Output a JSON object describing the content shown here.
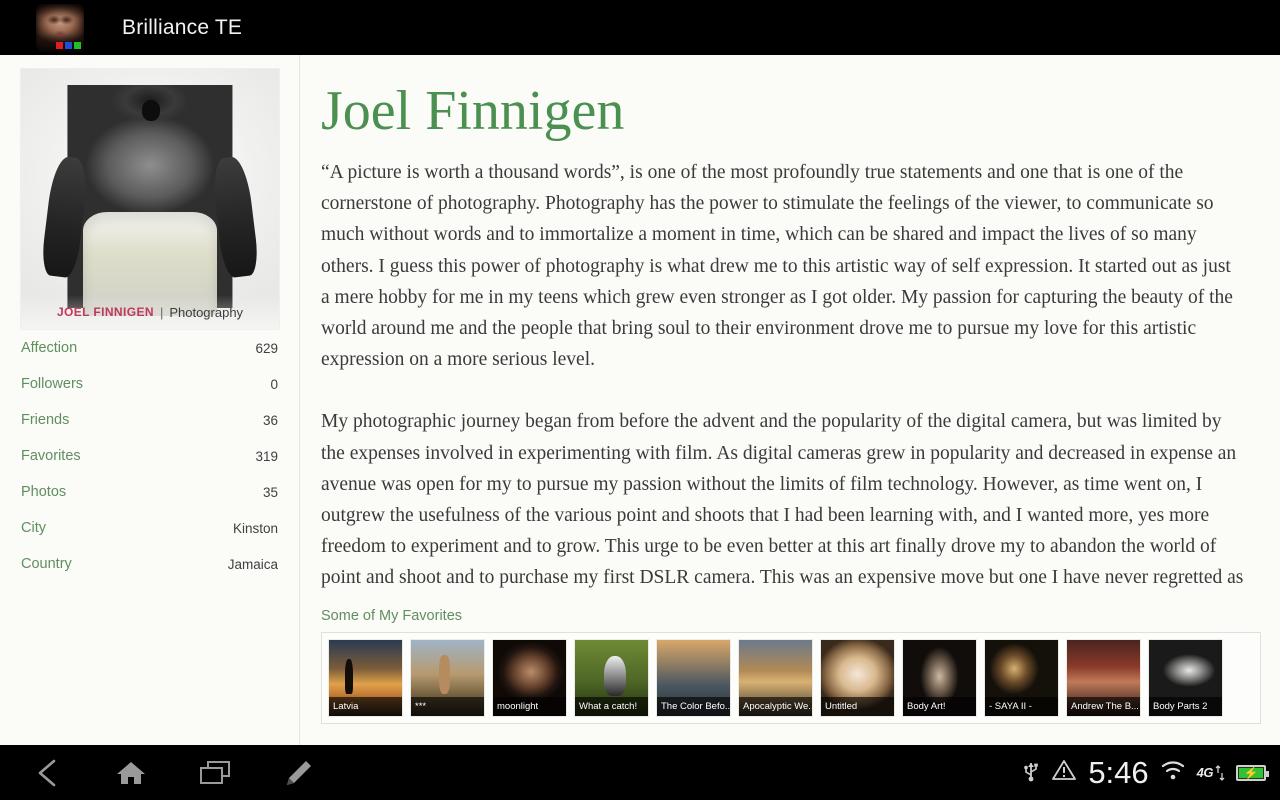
{
  "appbar": {
    "title": "Brilliance TE",
    "icon_name": "app-face-icon"
  },
  "sidebar": {
    "avatar": {
      "watermark_name": "JOEL FINNIGEN",
      "watermark_sep": "|",
      "watermark_kind": "Photography"
    },
    "stats": [
      {
        "label": "Affection",
        "value": "629"
      },
      {
        "label": "Followers",
        "value": "0"
      },
      {
        "label": "Friends",
        "value": "36"
      },
      {
        "label": "Favorites",
        "value": "319"
      },
      {
        "label": "Photos",
        "value": "35"
      },
      {
        "label": "City",
        "value": "Kinston"
      },
      {
        "label": "Country",
        "value": "Jamaica"
      }
    ]
  },
  "profile": {
    "name": "Joel Finnigen",
    "bio_paragraphs": [
      "“A picture is worth a thousand words”, is one of the most profoundly true statements and one that is one of the cornerstone of photography. Photography has the power to stimulate the feelings of the viewer, to communicate so much without words and to immortalize a moment in time, which can be shared and impact the lives of so many others. I guess this power of photography is what drew me to this artistic way of self expression. It started out as just a mere hobby for me in my teens which grew even stronger as I got older. My passion for capturing the beauty of the world around me and the people that bring soul to their environment drove me to pursue my love for this artistic expression on a more serious level.",
      "My photographic journey began from before the advent and the popularity of the digital camera, but was limited by the expenses involved in experimenting with film. As digital cameras grew in popularity and decreased in expense an avenue was open for my to pursue my passion without the limits of film technology. However, as time went on, I outgrew the usefulness of the various point and shoots that I had been learning with, and I wanted more, yes more freedom to experiment and to grow. This urge to be even better at this art finally drove my to abandon the world of point and shoot and to purchase my first DSLR camera. This was an expensive move but one I have never regretted as"
    ]
  },
  "favorites": {
    "heading": "Some of My Favorites",
    "items": [
      {
        "caption": "Latvia"
      },
      {
        "caption": "***"
      },
      {
        "caption": "moonlight"
      },
      {
        "caption": "What a catch!"
      },
      {
        "caption": "The Color Befo..."
      },
      {
        "caption": "Apocalyptic We..."
      },
      {
        "caption": "Untitled"
      },
      {
        "caption": "Body Art!"
      },
      {
        "caption": "- SAYA II -"
      },
      {
        "caption": "Andrew The B..."
      },
      {
        "caption": "Body Parts 2"
      }
    ]
  },
  "systembar": {
    "nav": [
      {
        "icon": "back-icon"
      },
      {
        "icon": "home-icon"
      },
      {
        "icon": "recents-icon"
      },
      {
        "icon": "edit-pencil-icon"
      }
    ],
    "status": {
      "usb_icon": "usb-icon",
      "warning_icon": "warning-triangle-icon",
      "clock": "5:46",
      "wifi_icon": "wifi-icon",
      "network_label": "4G",
      "battery_icon": "battery-charging-icon"
    }
  },
  "colors": {
    "accent_green": "#4a9050",
    "label_green": "#5f8f5f",
    "page_bg": "#fbfbf8",
    "bar_bg": "#000000"
  }
}
